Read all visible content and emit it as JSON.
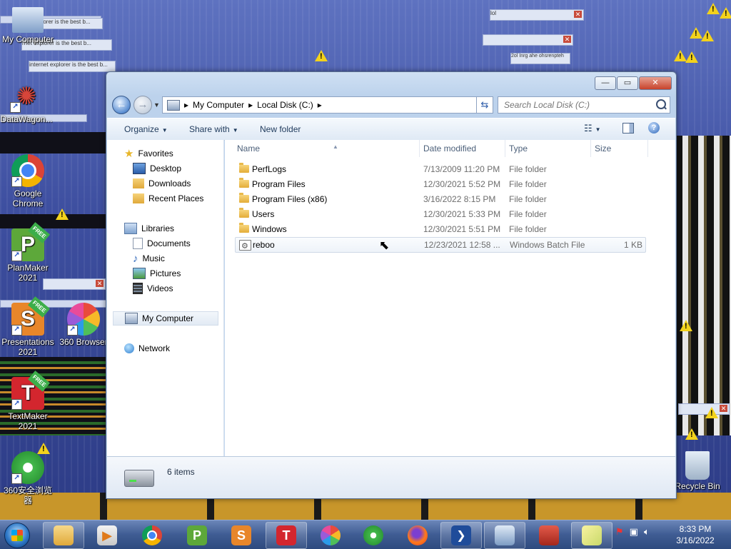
{
  "desktop": {
    "icons": [
      {
        "name": "my-computer",
        "label": "My Computer"
      },
      {
        "name": "datawagon",
        "label": "DataWagon..."
      },
      {
        "name": "google-chrome",
        "label": "Google Chrome"
      },
      {
        "name": "planmaker",
        "label": "PlanMaker 2021"
      },
      {
        "name": "presentations",
        "label": "Presentations 2021"
      },
      {
        "name": "360-browser",
        "label": "360 Browser"
      },
      {
        "name": "textmaker",
        "label": "TextMaker 2021"
      },
      {
        "name": "360-safe-browser",
        "label": "360安全浏览器"
      },
      {
        "name": "recycle-bin",
        "label": "Recycle Bin"
      }
    ],
    "free_badge": "FREE",
    "glitch_text_1": "ternet explorer is the best b...",
    "glitch_text_2": "rnet explorer is the best b...",
    "glitch_text_3": "internet explorer is the best b...",
    "glitch_text_4": "lol",
    "glitch_text_5": "2ol Inrg ahe ohsrenpteh"
  },
  "window": {
    "caption": {
      "minimize": "—",
      "maximize": "▭",
      "close": "✕"
    },
    "address": {
      "root": "My Computer",
      "current": "Local Disk (C:)"
    },
    "search_placeholder": "Search Local Disk (C:)",
    "toolbar": {
      "organize": "Organize",
      "share": "Share with",
      "new_folder": "New folder"
    },
    "nav": {
      "favorites": "Favorites",
      "desktop": "Desktop",
      "downloads": "Downloads",
      "recent": "Recent Places",
      "libraries": "Libraries",
      "documents": "Documents",
      "music": "Music",
      "pictures": "Pictures",
      "videos": "Videos",
      "computer": "My Computer",
      "network": "Network"
    },
    "columns": {
      "name": "Name",
      "date": "Date modified",
      "type": "Type",
      "size": "Size"
    },
    "files": [
      {
        "name": "PerfLogs",
        "date": "7/13/2009 11:20 PM",
        "type": "File folder",
        "size": ""
      },
      {
        "name": "Program Files",
        "date": "12/30/2021 5:52 PM",
        "type": "File folder",
        "size": ""
      },
      {
        "name": "Program Files (x86)",
        "date": "3/16/2022 8:15 PM",
        "type": "File folder",
        "size": ""
      },
      {
        "name": "Users",
        "date": "12/30/2021 5:33 PM",
        "type": "File folder",
        "size": ""
      },
      {
        "name": "Windows",
        "date": "12/30/2021 5:51 PM",
        "type": "File folder",
        "size": ""
      },
      {
        "name": "reboo",
        "date": "12/23/2021 12:58 ...",
        "type": "Windows Batch File",
        "size": "1 KB"
      }
    ],
    "status": "6 items"
  },
  "taskbar": {
    "clock_time": "8:33 PM",
    "clock_date": "3/16/2022"
  }
}
